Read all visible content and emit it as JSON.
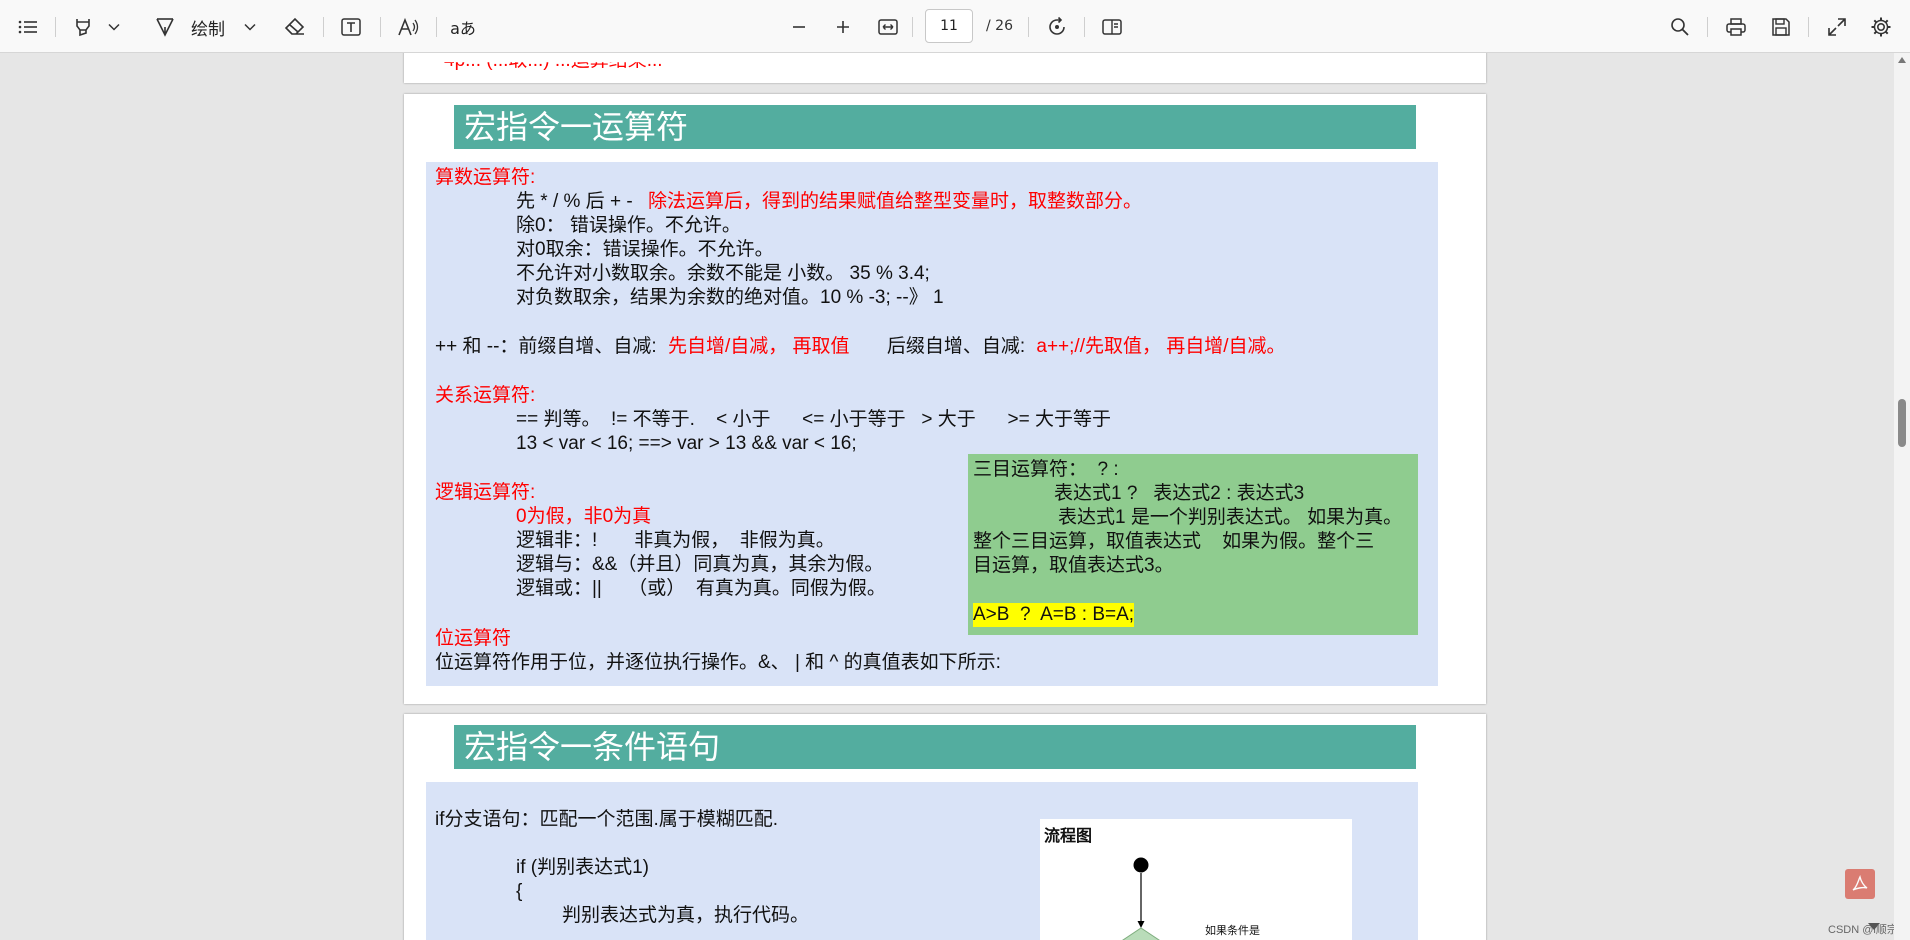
{
  "toolbar": {
    "draw_label": "绘制",
    "page_current": "11",
    "page_total": "/ 26",
    "aa_label": "aあ"
  },
  "page_prev": {
    "cut_text": "4p... (...取...) ...运算结果..."
  },
  "page1": {
    "banner": "宏指令一运算符",
    "arith_title": "算数运算符:",
    "arith_l1_black": "先 * / % 后 + -",
    "arith_l1_red": "除法运算后，得到的结果赋值给整型变量时，取整数部分。",
    "arith_l2": "除0：  错误操作。不允许。",
    "arith_l3": "对0取余：错误操作。不允许。",
    "arith_l4": "不允许对小数取余。余数不能是 小数。  35 % 3.4;",
    "arith_l5": "对负数取余，结果为余数的绝对值。10 % -3;  --》 1",
    "inc_black1": "++ 和 --：前缀自增、自减:",
    "inc_red1": "先自增/自减，  再取值",
    "inc_black2": "后缀自增、自减:",
    "inc_red2": "a++;//先取值，  再自增/自减。",
    "rel_title": "关系运算符:",
    "rel_l1": "== 判等。  != 不等于.    < 小于      <= 小于等于   > 大于      >= 大于等于",
    "rel_l2": "13 < var < 16; ==> var > 13 && var < 16;",
    "logic_title": "逻辑运算符:",
    "logic_l1": "0为假，非0为真",
    "logic_l2": "逻辑非：!       非真为假，  非假为真。",
    "logic_l3": "逻辑与：&&（并且）同真为真，其余为假。",
    "logic_l4": "逻辑或：||     （或）  有真为真。同假为假。",
    "bit_title": "位运算符",
    "bit_l1": "位运算符作用于位，并逐位执行操作。&、 | 和 ^ 的真值表如下所示:",
    "ternary_l1": "三目运算符：  ? :",
    "ternary_l2": "表达式1 ?   表达式2 : 表达式3",
    "ternary_l3": "表达式1 是一个判别表达式。 如果为真。",
    "ternary_l4": "整个三目运算，取值表达式    如果为假。整个三",
    "ternary_l5": "目运算，取值表达式3。",
    "ternary_example": "A>B  ?  A=B : B=A;"
  },
  "page2": {
    "banner": "宏指令一条件语句",
    "if_l1": "if分支语句：匹配一个范围.属于模糊匹配.",
    "if_l2": "if (判别表达式1)",
    "if_l3": "{",
    "if_l4": "判别表达式为真，执行代码。",
    "flow_title": "流程图",
    "flow_note": "如果条件是"
  },
  "footer": {
    "watermark": "CSDN @l顺宗"
  },
  "colors": {
    "banner": "#53ad9f",
    "content_bg": "#d9e3f7",
    "ternary_bg": "#8fcc8f",
    "highlight": "#ffff00",
    "accent_red": "#ff0000"
  }
}
